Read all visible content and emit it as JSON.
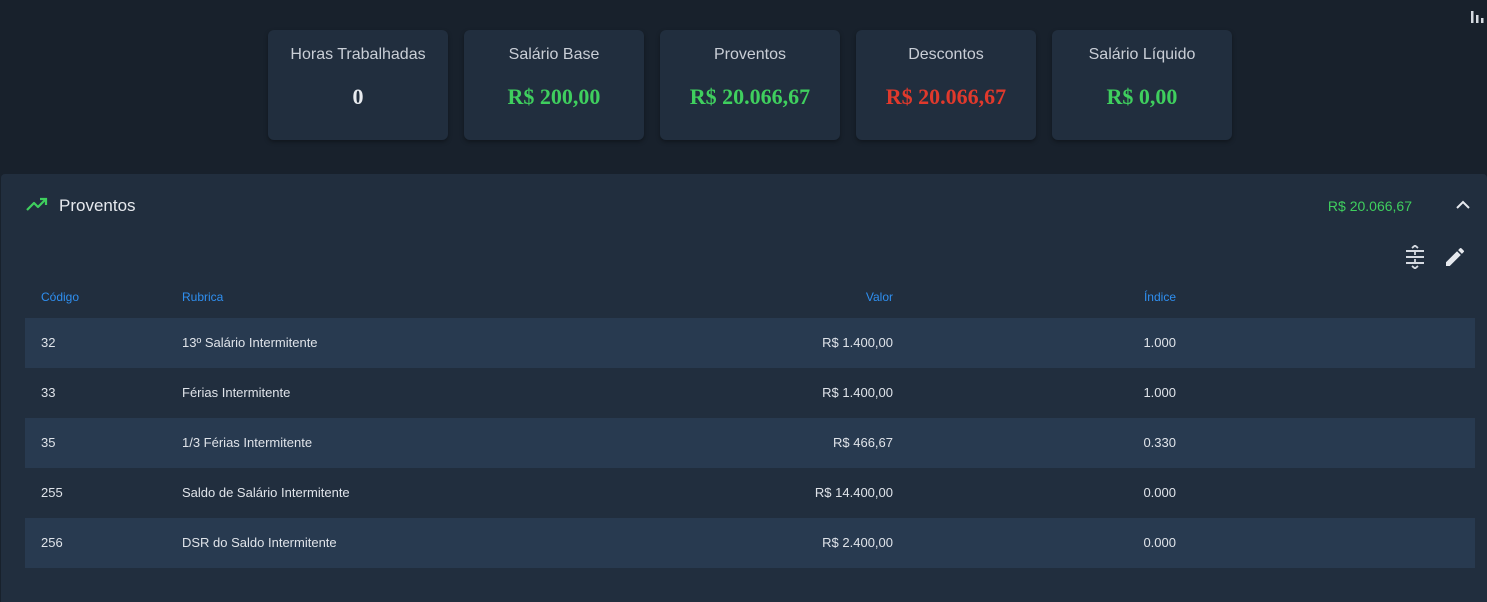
{
  "summary_cards": [
    {
      "label": "Horas Trabalhadas",
      "value": "0",
      "color": "#e8ebef"
    },
    {
      "label": "Salário Base",
      "value": "R$ 200,00",
      "color": "#3fcf5e"
    },
    {
      "label": "Proventos",
      "value": "R$ 20.066,67",
      "color": "#3fcf5e"
    },
    {
      "label": "Descontos",
      "value": "R$ 20.066,67",
      "color": "#e0392c"
    },
    {
      "label": "Salário Líquido",
      "value": "R$ 0,00",
      "color": "#3fcf5e"
    }
  ],
  "panel": {
    "title": "Proventos",
    "total": "R$ 20.066,67",
    "icon": "trending-up-icon",
    "accent": "#3fcf5e"
  },
  "table": {
    "columns": {
      "code": "Código",
      "name": "Rubrica",
      "value": "Valor",
      "index": "Índice"
    },
    "rows": [
      {
        "code": "32",
        "name": "13º Salário Intermitente",
        "value": "R$ 1.400,00",
        "index": "1.000"
      },
      {
        "code": "33",
        "name": "Férias Intermitente",
        "value": "R$ 1.400,00",
        "index": "1.000"
      },
      {
        "code": "35",
        "name": "1/3 Férias Intermitente",
        "value": "R$ 466,67",
        "index": "0.330"
      },
      {
        "code": "255",
        "name": "Saldo de Salário Intermitente",
        "value": "R$ 14.400,00",
        "index": "0.000"
      },
      {
        "code": "256",
        "name": "DSR do Saldo Intermitente",
        "value": "R$ 2.400,00",
        "index": "0.000"
      }
    ]
  },
  "icons": {
    "corner": "bar-chart-icon",
    "collapse": "chevron-up-icon",
    "density": "row-density-icon",
    "edit": "pencil-icon"
  }
}
